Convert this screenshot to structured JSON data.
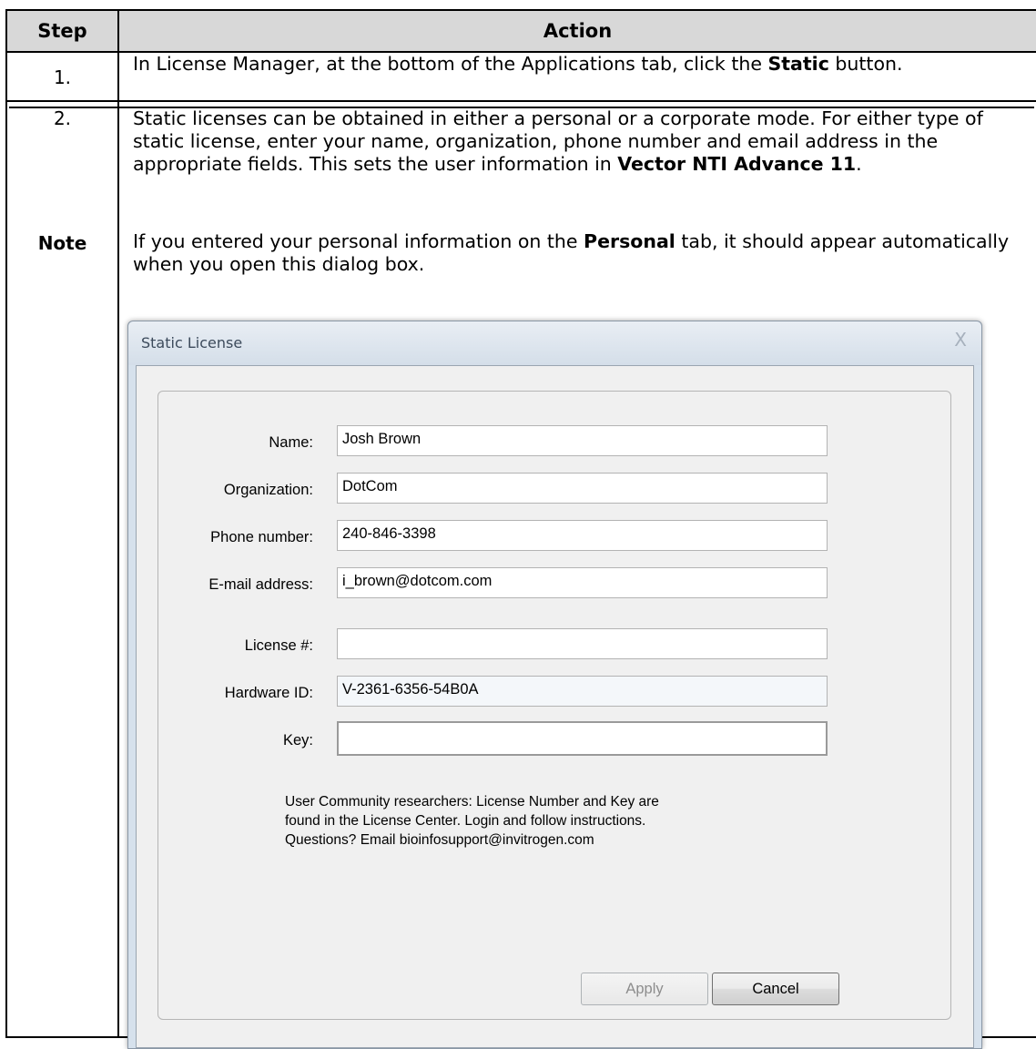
{
  "table": {
    "header_step": "Step",
    "header_action": "Action",
    "rows": [
      {
        "step": "1.",
        "text_parts": [
          "In License Manager, at the bottom of the Applications tab, click the ",
          "Static",
          " button."
        ]
      },
      {
        "step": "2.",
        "text_parts": [
          "Static licenses can be obtained in either a personal or a corporate mode. For either type of static license, enter your name, organization, phone number and email address in the appropriate fields. This sets the user information in ",
          "Vector NTI Advance 11",
          "."
        ]
      },
      {
        "step": "Note",
        "text_parts": [
          "If you entered your personal information on the ",
          "Personal",
          " tab, it should appear automatically when you open this dialog box."
        ]
      }
    ]
  },
  "dialog": {
    "title": "Static License",
    "close_glyph": "X",
    "fields": {
      "name": {
        "label": "Name:",
        "value": "Josh Brown"
      },
      "organization": {
        "label": "Organization:",
        "value": "DotCom"
      },
      "phone": {
        "label": "Phone number:",
        "value": "240-846-3398"
      },
      "email": {
        "label": "E-mail address:",
        "value": "i_brown@dotcom.com"
      },
      "license": {
        "label": "License #:",
        "value": ""
      },
      "hardware": {
        "label": "Hardware ID:",
        "value": "V-2361-6356-54B0A"
      },
      "key": {
        "label": "Key:",
        "value": ""
      }
    },
    "info_lines": [
      "User Community researchers:  License Number and Key are",
      "found in the License Center.  Login and follow instructions.",
      "Questions? Email bioinfosupport@invitrogen.com"
    ],
    "buttons": {
      "apply": "Apply",
      "cancel": "Cancel"
    }
  }
}
